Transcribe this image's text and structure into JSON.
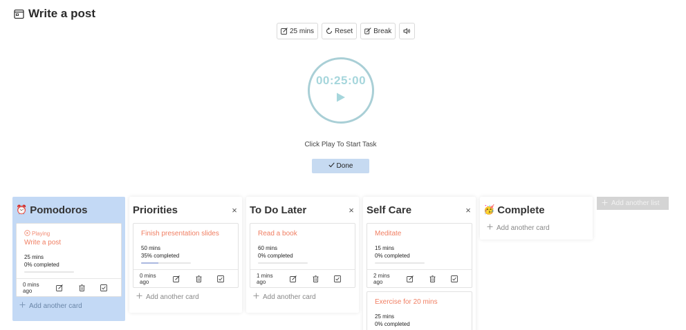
{
  "header": {
    "title": "Write a post",
    "icon": "calendar-icon"
  },
  "toolbar": {
    "duration_label": "25 mins",
    "reset_label": "Reset",
    "break_label": "Break",
    "sound_icon": "speaker-icon"
  },
  "timer": {
    "time": "00:25:00",
    "instruction": "Click Play To Start Task",
    "done_label": "Done"
  },
  "colors": {
    "accent": "#f07e62",
    "active_list": "#c3d9f5",
    "timer_text": "#a6d6dc",
    "done_button": "#c6daf1"
  },
  "board": {
    "add_list_label": "Add another list",
    "lists": [
      {
        "title": "Pomodoros",
        "emoji": "⏰",
        "add_card_label": "Add another card",
        "cards": [
          {
            "status": "Playing",
            "title": "Write a post",
            "duration": "25 mins",
            "completed": "0% completed",
            "progress": 0,
            "ago": "0 mins ago"
          }
        ]
      },
      {
        "title": "Priorities",
        "close": "×",
        "add_card_label": "Add another card",
        "cards": [
          {
            "title": "Finish presentation slides",
            "duration": "50 mins",
            "completed": "35% completed",
            "progress": 0.35,
            "ago": "0 mins ago"
          }
        ]
      },
      {
        "title": "To Do Later",
        "close": "×",
        "add_card_label": "Add another card",
        "cards": [
          {
            "title": "Read a book",
            "duration": "60 mins",
            "completed": "0% completed",
            "progress": 0,
            "ago": "1 mins ago"
          }
        ]
      },
      {
        "title": "Self Care",
        "close": "×",
        "cards": [
          {
            "title": "Meditate",
            "duration": "15 mins",
            "completed": "0% completed",
            "progress": 0,
            "ago": "2 mins ago"
          },
          {
            "title": "Exercise for 20 mins",
            "duration": "25 mins",
            "completed": "0% completed"
          }
        ]
      },
      {
        "title": "Complete",
        "emoji": "🥳",
        "add_card_label": "Add another card"
      }
    ]
  }
}
